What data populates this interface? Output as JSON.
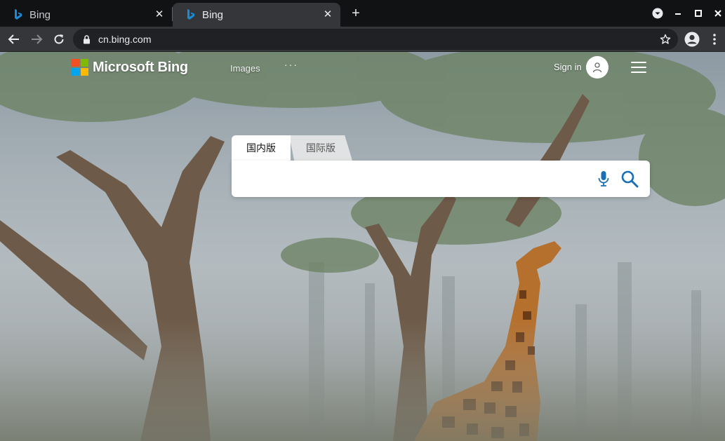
{
  "browser": {
    "tabs": [
      {
        "title": "Bing",
        "active": false,
        "favicon": "bing-icon"
      },
      {
        "title": "Bing",
        "active": true,
        "favicon": "bing-icon"
      }
    ],
    "address_bar": {
      "url": "cn.bing.com"
    }
  },
  "page": {
    "logo_text": "Microsoft Bing",
    "nav": {
      "images_label": "Images",
      "more_label": "···"
    },
    "header": {
      "sign_in_label": "Sign in"
    },
    "search": {
      "scope_tabs": [
        {
          "label": "国内版",
          "selected": true
        },
        {
          "label": "国际版",
          "selected": false
        }
      ],
      "query": ""
    }
  },
  "colors": {
    "bing_accent": "#1a6fb5",
    "ms_red": "#f25022",
    "ms_green": "#7fba00",
    "ms_blue": "#00a4ef",
    "ms_yellow": "#ffb900"
  }
}
